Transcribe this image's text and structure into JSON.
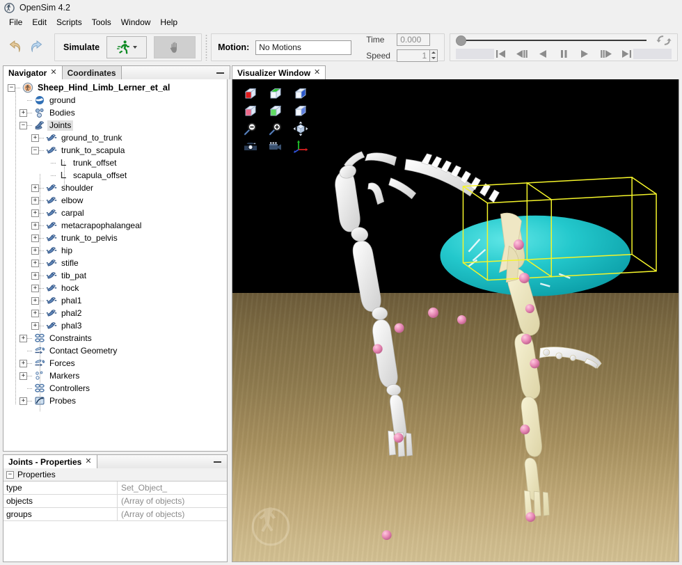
{
  "window": {
    "title": "OpenSim 4.2",
    "icon": "opensim-logo-icon"
  },
  "menubar": {
    "items": [
      "File",
      "Edit",
      "Scripts",
      "Tools",
      "Window",
      "Help"
    ]
  },
  "toolbar": {
    "undo_icon": "undo-arrow-icon",
    "redo_icon": "redo-arrow-icon",
    "simulate_label": "Simulate",
    "run_icon": "green-runner-icon",
    "run_dropdown_icon": "caret-down-icon",
    "stop_icon": "gray-hand-stop-icon",
    "motion_label": "Motion:",
    "motion_value": "No Motions",
    "motion_placeholder": "No Motions",
    "time_label": "Time",
    "time_value": "0.000",
    "speed_label": "Speed",
    "speed_value": "1",
    "loop_icon": "loop-repeat-icon",
    "transport": [
      {
        "name": "skip-to-start-button",
        "glyph": "skip-start"
      },
      {
        "name": "step-back-button",
        "glyph": "step-back"
      },
      {
        "name": "play-backward-button",
        "glyph": "play-back"
      },
      {
        "name": "pause-button",
        "glyph": "pause"
      },
      {
        "name": "play-forward-button",
        "glyph": "play-fwd"
      },
      {
        "name": "step-forward-button",
        "glyph": "step-fwd"
      },
      {
        "name": "skip-to-end-button",
        "glyph": "skip-end"
      }
    ]
  },
  "navigator": {
    "tabs": [
      {
        "label": "Navigator",
        "active": true,
        "closable": true
      },
      {
        "label": "Coordinates",
        "active": false,
        "closable": false
      }
    ],
    "minimize_icon": "minimize-icon",
    "tree": [
      {
        "label": "Sheep_Hind_Limb_Lerner_et_al",
        "depth": 0,
        "toggle": "minus",
        "icon": "model-icon",
        "root": true
      },
      {
        "label": "ground",
        "depth": 1,
        "toggle": "none",
        "icon": "ground-icon"
      },
      {
        "label": "Bodies",
        "depth": 1,
        "toggle": "plus",
        "icon": "bodies-icon"
      },
      {
        "label": "Joints",
        "depth": 1,
        "toggle": "minus",
        "icon": "joints-icon",
        "selected": true
      },
      {
        "label": "ground_to_trunk",
        "depth": 2,
        "toggle": "plus",
        "icon": "joint-icon"
      },
      {
        "label": "trunk_to_scapula",
        "depth": 2,
        "toggle": "minus",
        "icon": "joint-icon"
      },
      {
        "label": "trunk_offset",
        "depth": 3,
        "toggle": "none",
        "icon": "frame-icon"
      },
      {
        "label": "scapula_offset",
        "depth": 3,
        "toggle": "none",
        "icon": "frame-icon"
      },
      {
        "label": "shoulder",
        "depth": 2,
        "toggle": "plus",
        "icon": "joint-icon"
      },
      {
        "label": "elbow",
        "depth": 2,
        "toggle": "plus",
        "icon": "joint-icon"
      },
      {
        "label": "carpal",
        "depth": 2,
        "toggle": "plus",
        "icon": "joint-icon"
      },
      {
        "label": "metacrapophalangeal",
        "depth": 2,
        "toggle": "plus",
        "icon": "joint-icon"
      },
      {
        "label": "trunk_to_pelvis",
        "depth": 2,
        "toggle": "plus",
        "icon": "joint-icon"
      },
      {
        "label": "hip",
        "depth": 2,
        "toggle": "plus",
        "icon": "joint-icon"
      },
      {
        "label": "stifle",
        "depth": 2,
        "toggle": "plus",
        "icon": "joint-icon"
      },
      {
        "label": "tib_pat",
        "depth": 2,
        "toggle": "plus",
        "icon": "joint-icon"
      },
      {
        "label": "hock",
        "depth": 2,
        "toggle": "plus",
        "icon": "joint-icon"
      },
      {
        "label": "phal1",
        "depth": 2,
        "toggle": "plus",
        "icon": "joint-icon"
      },
      {
        "label": "phal2",
        "depth": 2,
        "toggle": "plus",
        "icon": "joint-icon"
      },
      {
        "label": "phal3",
        "depth": 2,
        "toggle": "plus",
        "icon": "joint-icon"
      },
      {
        "label": "Constraints",
        "depth": 1,
        "toggle": "plus",
        "icon": "constraints-icon"
      },
      {
        "label": "Contact Geometry",
        "depth": 1,
        "toggle": "none",
        "icon": "contact-geometry-icon"
      },
      {
        "label": "Forces",
        "depth": 1,
        "toggle": "plus",
        "icon": "forces-icon"
      },
      {
        "label": "Markers",
        "depth": 1,
        "toggle": "plus",
        "icon": "markers-icon"
      },
      {
        "label": "Controllers",
        "depth": 1,
        "toggle": "none",
        "icon": "controllers-icon"
      },
      {
        "label": "Probes",
        "depth": 1,
        "toggle": "plus",
        "icon": "probes-icon"
      }
    ]
  },
  "properties": {
    "tab_label": "Joints - Properties",
    "minimize_icon": "minimize-icon",
    "group_label": "Properties",
    "group_toggle": "minus",
    "rows": [
      {
        "name": "type",
        "value": "Set_Object_"
      },
      {
        "name": "objects",
        "value": "(Array of objects)"
      },
      {
        "name": "groups",
        "value": "(Array of objects)"
      }
    ]
  },
  "visualizer": {
    "tab_label": "Visualizer Window",
    "closable": true,
    "tools": [
      {
        "name": "view-front-icon",
        "glyph": "cube-red-front"
      },
      {
        "name": "view-top-icon",
        "glyph": "cube-green-top"
      },
      {
        "name": "view-right-icon",
        "glyph": "cube-blue-side"
      },
      {
        "name": "view-back-icon",
        "glyph": "cube-pink-back"
      },
      {
        "name": "view-bottom-icon",
        "glyph": "cube-green-bottom"
      },
      {
        "name": "view-left-icon",
        "glyph": "cube-blue-left"
      },
      {
        "name": "zoom-out-icon",
        "glyph": "magnifier-minus"
      },
      {
        "name": "zoom-in-icon",
        "glyph": "magnifier-plus"
      },
      {
        "name": "fit-to-window-icon",
        "glyph": "cube-arrows"
      },
      {
        "name": "take-snapshot-icon",
        "glyph": "camera"
      },
      {
        "name": "record-movie-icon",
        "glyph": "video-camera"
      },
      {
        "name": "toggle-axes-icon",
        "glyph": "xyz-axes"
      }
    ],
    "watermark_icon": "opensim-watermark-icon",
    "scene": {
      "background_color": "#000000",
      "ground_color": "#8e7a4e",
      "trunk_ellipsoid_color": "#1fc0c4",
      "bone_color": "#f2f0ea",
      "bone_highlight_color": "#efe9c4",
      "marker_color": "#e894bd",
      "selection_box_color": "#f5f52a"
    }
  },
  "colors": {
    "accent": "#1fc0c4",
    "selection": "#f5f52a",
    "run_green": "#0e8a23",
    "panel_bg": "#f0f0f0"
  }
}
